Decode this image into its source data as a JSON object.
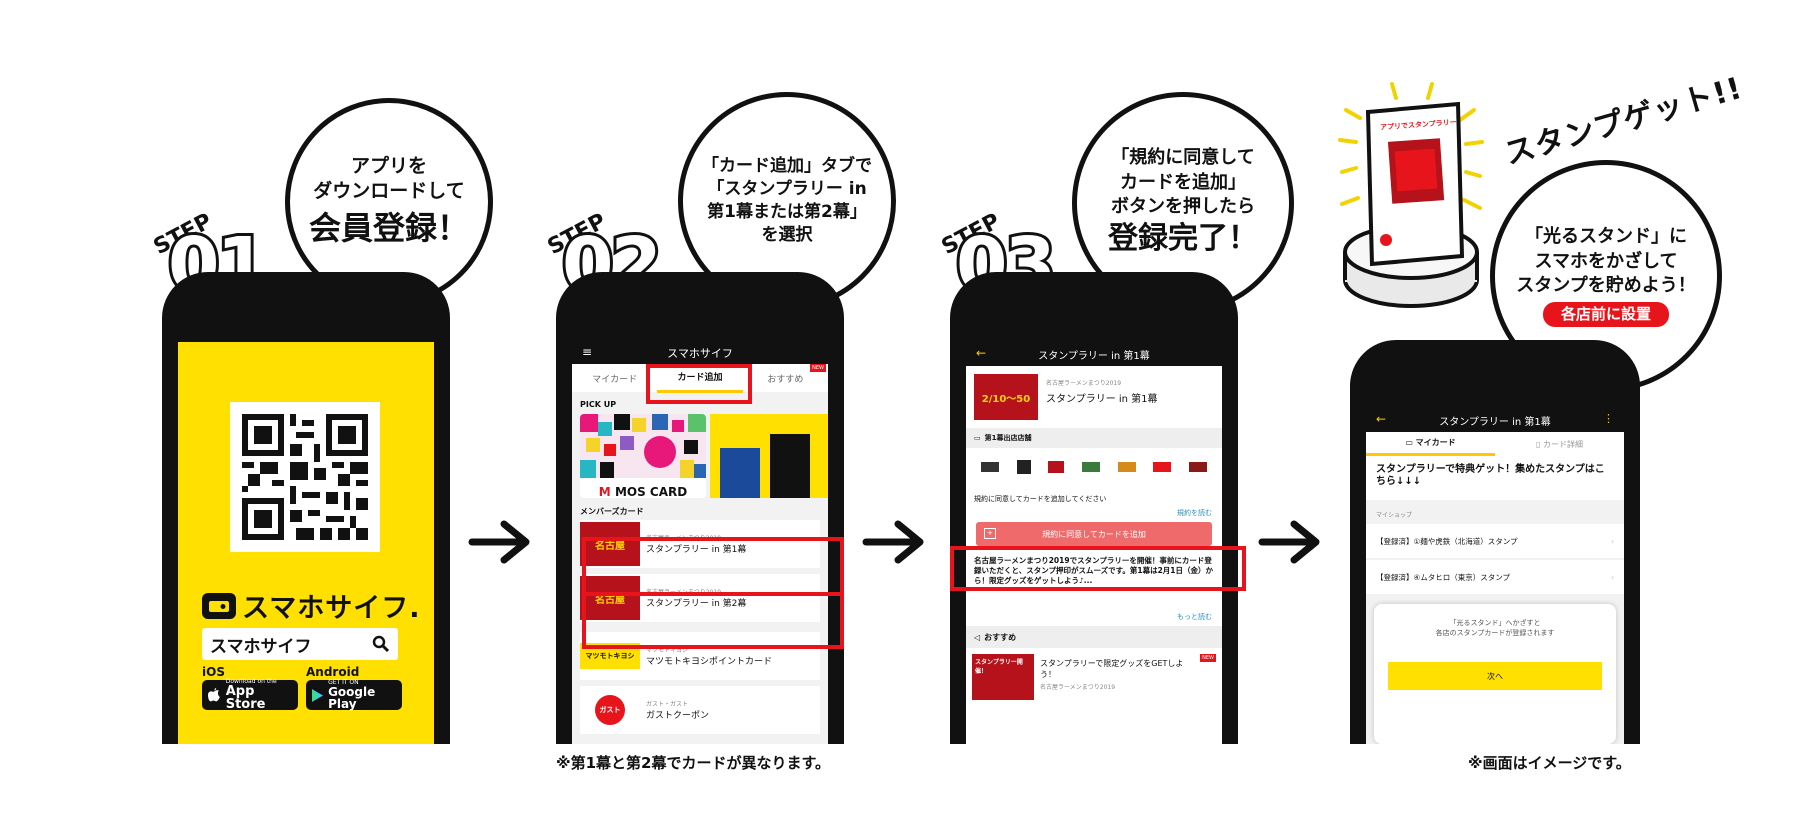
{
  "steps": [
    {
      "label": "STEP",
      "number": "01"
    },
    {
      "label": "STEP",
      "number": "02"
    },
    {
      "label": "STEP",
      "number": "03"
    }
  ],
  "bubbles": {
    "b1": {
      "line1": "アプリを",
      "line2": "ダウンロードして",
      "line3": "会員登録！"
    },
    "b2": {
      "line1": "「カード追加」タブで",
      "line2": "「スタンプラリー in",
      "line3": "第1幕または第2幕」",
      "line4": "を選択"
    },
    "b3": {
      "line1": "「規約に同意して",
      "line2": "カードを追加」",
      "line3": "ボタンを押したら",
      "line4": "登録完了！"
    },
    "b4": {
      "line1": "「光るスタンド」に",
      "line2": "スマホをかざして",
      "line3": "スタンプを貯めよう！",
      "badge": "各店前に設置"
    }
  },
  "stamp_get": "スタンプゲット!!",
  "phone1": {
    "brand": "スマホサイフ.",
    "search_value": "スマホサイフ",
    "ios_label": "iOS",
    "android_label": "Android",
    "appstore_small": "Download on the",
    "appstore_big": "App Store",
    "gplay_small": "GET IT ON",
    "gplay_big": "Google Play"
  },
  "phone2": {
    "title": "スマホサイフ",
    "tabs": [
      "マイカード",
      "カード追加",
      "おすすめ"
    ],
    "new_badge": "NEW",
    "pickup": "PICK UP",
    "mos_card": "MOS CARD",
    "members": "メンバーズカード",
    "cards": [
      {
        "sub": "名古屋ラーメンまつり2019",
        "name": "スタンプラリー in 第1幕"
      },
      {
        "sub": "名古屋ラーメンまつり2019",
        "name": "スタンプラリー in 第2幕"
      },
      {
        "sub": "マツモトキヨシ",
        "name": "マツモトキヨシポイントカード",
        "logo": "マツモトキヨシ"
      },
      {
        "sub": "ガスト・ガスト",
        "name": "ガストクーポン",
        "logo": "ガスト"
      }
    ]
  },
  "phone3": {
    "title": "スタンプラリー in 第1幕",
    "card_sub": "名古屋ラーメンまつり2019",
    "card_name": "スタンプラリー in 第1幕",
    "card_dates": "2/10〜50",
    "shops_header": "第1幕出店店舗",
    "agree_prompt": "規約に同意してカードを追加してください",
    "terms_link": "規約を読む",
    "add_button": "規約に同意してカードを追加",
    "description": "名古屋ラーメンまつり2019でスタンプラリーを開催！事前にカード登録いただくと、スタンプ押印がスムーズです。第1幕は2月1日（金）から！限定グッズをゲットしよう♪...",
    "more_link": "もっと読む",
    "recommend_header": "おすすめ",
    "rec_text": "スタンプラリーで限定グッズをGETしよう！",
    "rec_sub": "名古屋ラーメンまつり2019",
    "rec_banner": "スタンプラリー開催！",
    "new_badge": "NEW"
  },
  "phone4": {
    "title": "スタンプラリー in 第1幕",
    "tabs": [
      "マイカード",
      "カード詳細"
    ],
    "headline": "スタンプラリーで特典ゲット！集めたスタンプはこちら↓↓↓",
    "section": "マイショップ",
    "shops": [
      "【登録済】①麺や虎鉄（北海道）スタンプ",
      "【登録済】④ムタヒロ（東京）スタンプ"
    ],
    "modal_text1": "「光るスタンド」へかざすと",
    "modal_text2": "各店のスタンプカードが登録されます",
    "next_button": "次へ"
  },
  "stand": {
    "title": "アプリでスタンプラリー"
  },
  "notes": {
    "left": "※第1幕と第2幕でカードが異なります。",
    "right": "※画面はイメージです。"
  },
  "colors": {
    "yellow": "#ffe000",
    "red": "#e8141c",
    "salmon": "#ef6a6a",
    "darkred": "#b5121b",
    "link": "#2a8fbd"
  }
}
